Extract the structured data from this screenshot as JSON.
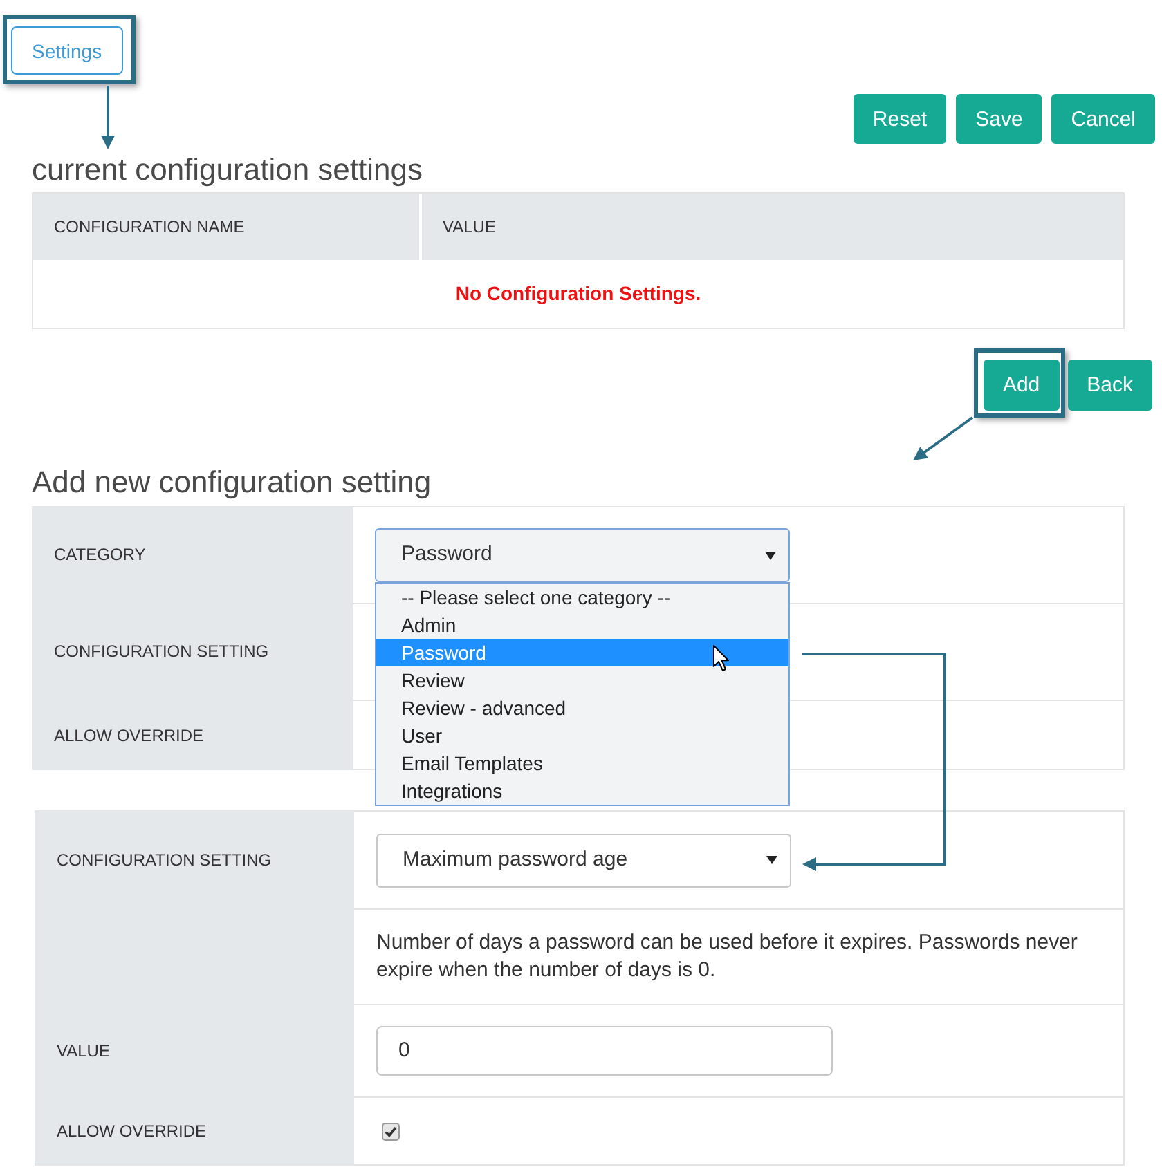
{
  "toolbar": {
    "settings_button": {
      "label": "Settings",
      "highlighted": true
    },
    "actions": [
      {
        "label": "Reset",
        "highlighted": false
      },
      {
        "label": "Save",
        "highlighted": false
      },
      {
        "label": "Cancel",
        "highlighted": false
      }
    ]
  },
  "current_settings": {
    "title": "current configuration settings",
    "columns": [
      "CONFIGURATION NAME",
      "VALUE"
    ],
    "empty_message": "No Configuration Settings."
  },
  "list_actions": [
    {
      "label": "Add",
      "highlighted": true
    },
    {
      "label": "Back",
      "highlighted": false
    }
  ],
  "add_form": {
    "title": "Add new configuration setting",
    "rows": [
      {
        "kind": "select",
        "label": "CATEGORY",
        "value": "Password",
        "expanded": true,
        "options": [
          {
            "label": "-- Please select one category --",
            "selected": false
          },
          {
            "label": "Admin",
            "selected": false
          },
          {
            "label": "Password",
            "selected": true
          },
          {
            "label": "Review",
            "selected": false
          },
          {
            "label": "Review - advanced",
            "selected": false
          },
          {
            "label": "User",
            "selected": false
          },
          {
            "label": "Email Templates",
            "selected": false
          },
          {
            "label": "Integrations",
            "selected": false
          }
        ]
      },
      {
        "kind": "blank",
        "label": "CONFIGURATION SETTING"
      },
      {
        "kind": "blank",
        "label": "ALLOW OVERRIDE"
      }
    ]
  },
  "setting_form": {
    "rows": [
      {
        "kind": "select",
        "label": "CONFIGURATION SETTING",
        "value": "Maximum password age",
        "expanded": false
      },
      {
        "kind": "description",
        "text": "Number of days a password can be used before it expires. Passwords never expire when the number of days is 0."
      },
      {
        "kind": "input",
        "label": "VALUE",
        "value": "0"
      },
      {
        "kind": "checkbox",
        "label": "ALLOW OVERRIDE",
        "checked": true
      }
    ]
  }
}
